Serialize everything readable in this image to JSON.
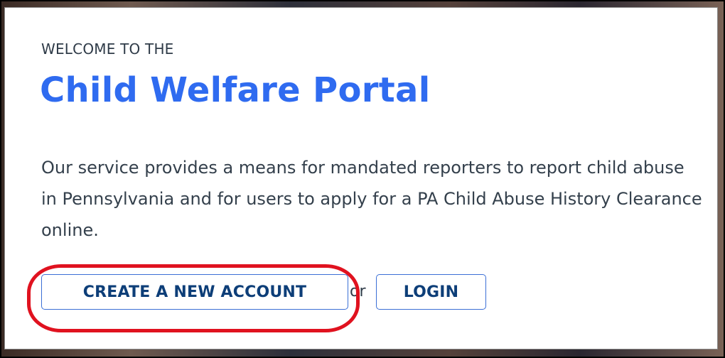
{
  "hero": {
    "welcome_text": "WELCOME TO THE",
    "title": "Child Welfare Portal",
    "description": "Our service provides a means for mandated reporters to report child abuse in Pennsylvania and for users to apply for a PA Child Abuse History Clearance online."
  },
  "actions": {
    "create_account_label": "CREATE A NEW ACCOUNT",
    "separator_text": "or",
    "login_label": "LOGIN"
  },
  "colors": {
    "title_blue": "#2f6bf0",
    "button_text": "#0d3e78",
    "button_border": "#3b6fd6",
    "annotation_red": "#e0121f"
  }
}
